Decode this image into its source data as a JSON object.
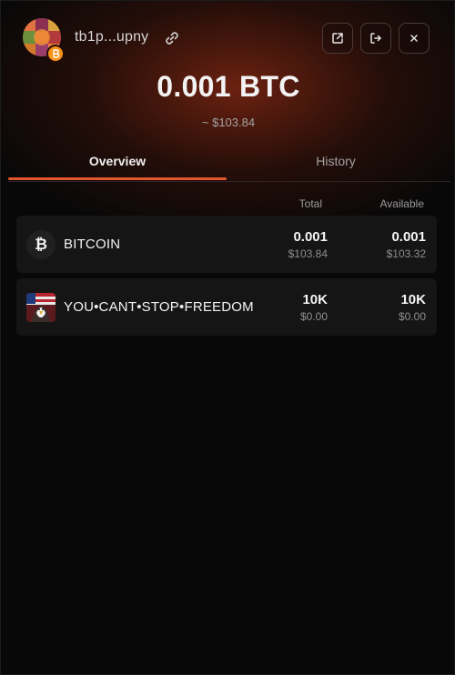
{
  "header": {
    "address": "tb1p...upny",
    "buttons": [
      {
        "icon": "external-link-icon"
      },
      {
        "icon": "logout-icon"
      },
      {
        "icon": "close-icon"
      }
    ]
  },
  "balance": {
    "amount": "0.001 BTC",
    "usd": "~ $103.84"
  },
  "tabs": [
    {
      "label": "Overview",
      "active": true
    },
    {
      "label": "History",
      "active": false
    }
  ],
  "table": {
    "columns": [
      "Total",
      "Available"
    ],
    "rows": [
      {
        "name": "BITCOIN",
        "icon_glyph": "₿",
        "total": "0.001",
        "total_usd": "$103.84",
        "available": "0.001",
        "available_usd": "$103.32"
      },
      {
        "name": "YOU•CANT•STOP•FREEDOM",
        "icon": "rune-image-icon",
        "total": "10K",
        "total_usd": "$0.00",
        "available": "10K",
        "available_usd": "$0.00"
      }
    ]
  },
  "colors": {
    "accent": "#e4572e",
    "background": "#080808",
    "row_bg": "#151515",
    "bitcoin_orange": "#f7931a"
  }
}
